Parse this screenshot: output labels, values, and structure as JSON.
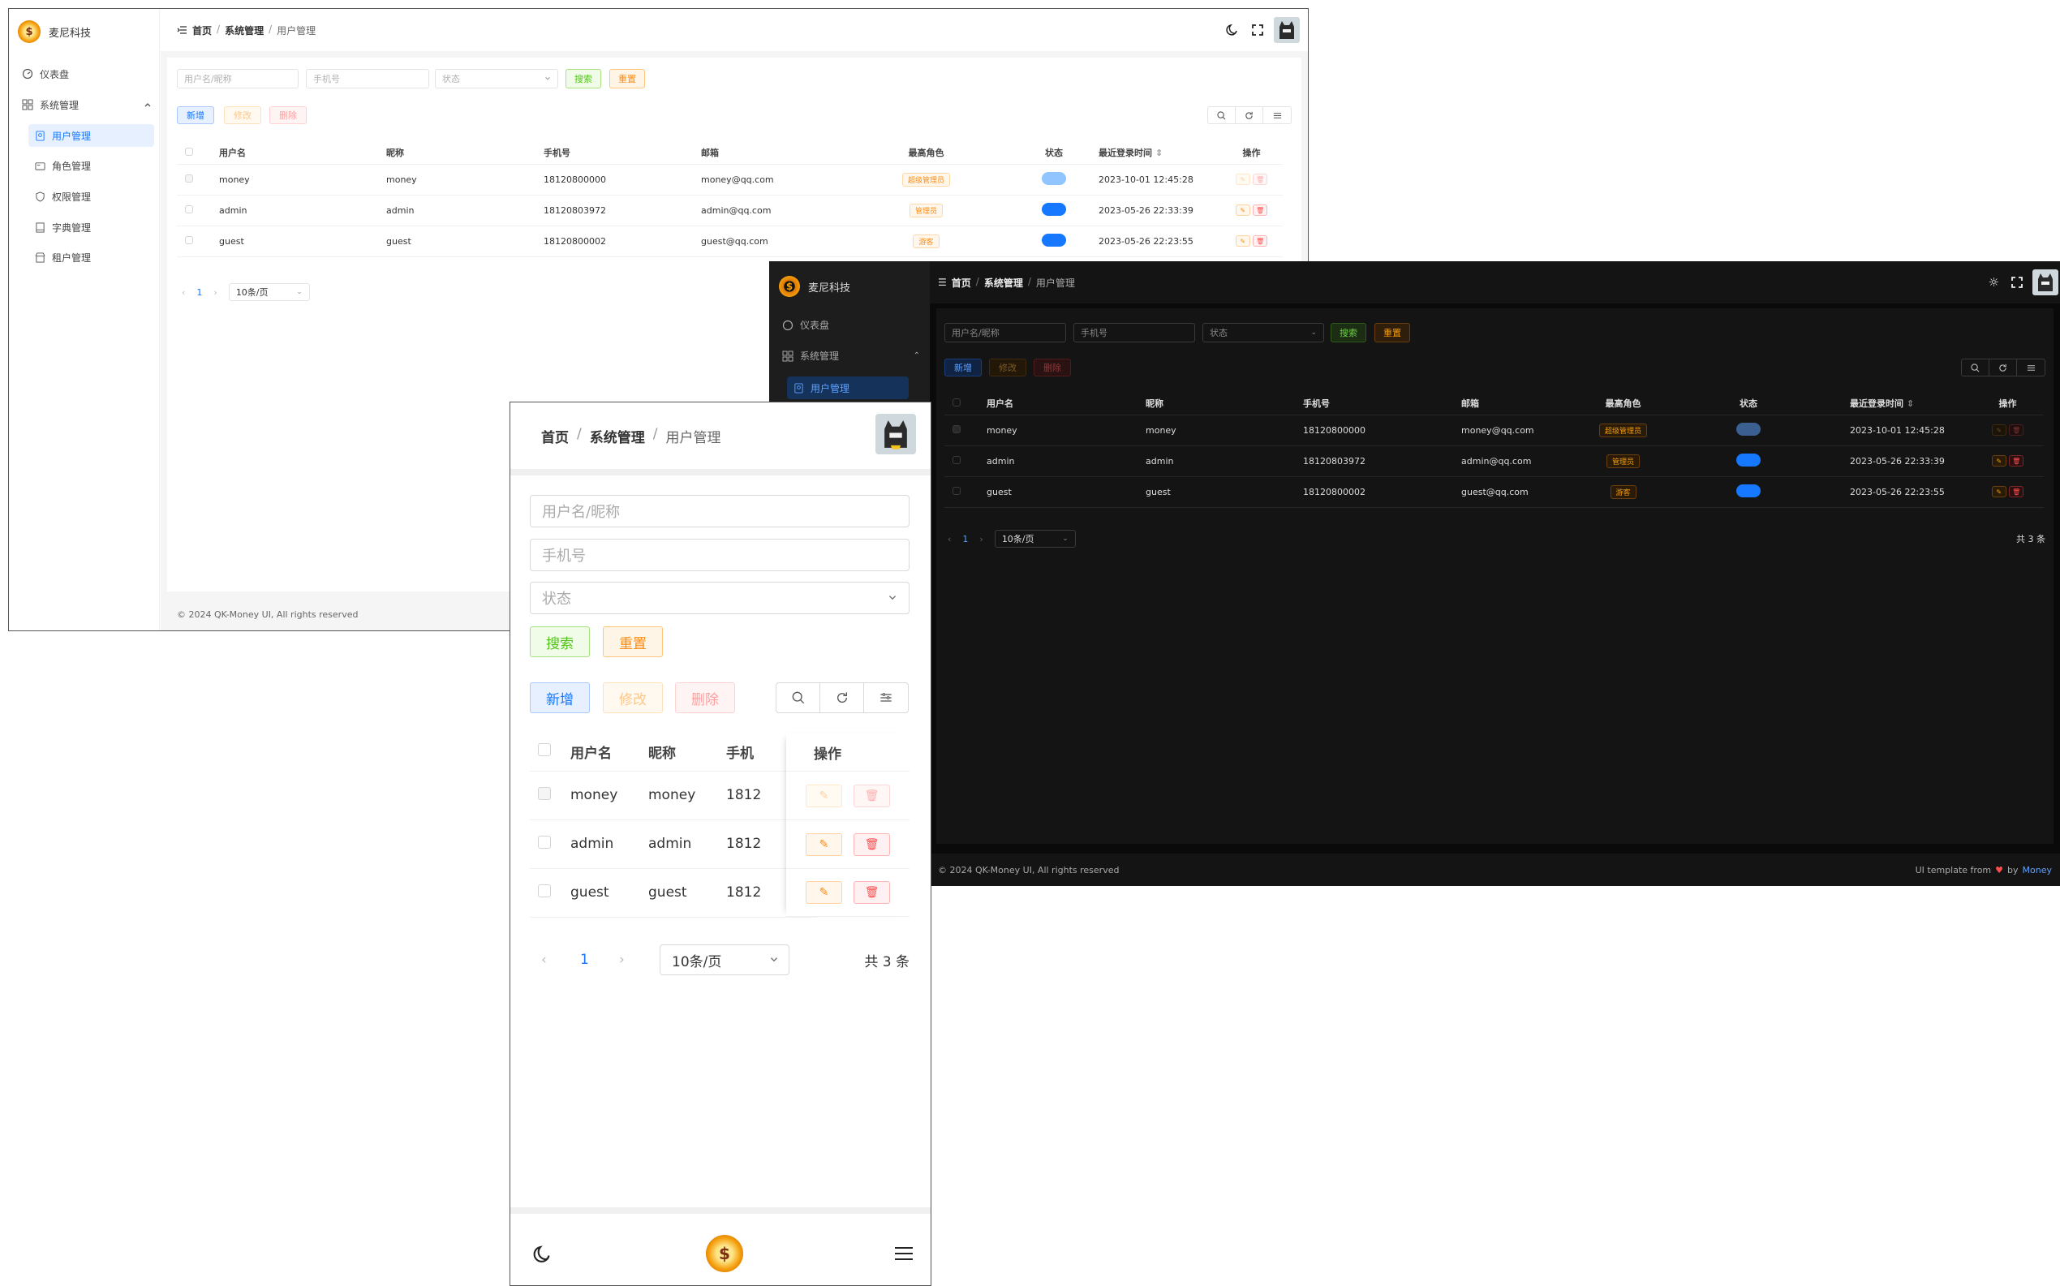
{
  "app": {
    "brand": "麦尼科技",
    "breadcrumb": [
      "首页",
      "系统管理",
      "用户管理"
    ],
    "footer_copyright": "© 2024 QK-Money UI, All rights reserved",
    "footer_credit_prefix": "UI template from",
    "footer_credit_by": "by",
    "footer_credit_author": "Money"
  },
  "sidebar": {
    "dashboard": "仪表盘",
    "system": "系统管理",
    "items": [
      "用户管理",
      "角色管理",
      "权限管理",
      "字典管理",
      "租户管理"
    ],
    "active_index": 0
  },
  "search": {
    "username_placeholder": "用户名/昵称",
    "phone_placeholder": "手机号",
    "status_placeholder": "状态",
    "search_label": "搜索",
    "reset_label": "重置"
  },
  "toolbar": {
    "add_label": "新增",
    "edit_label": "修改",
    "delete_label": "删除"
  },
  "table": {
    "columns": [
      "用户名",
      "昵称",
      "手机号",
      "邮箱",
      "最高角色",
      "状态",
      "最近登录时间",
      "操作"
    ],
    "rows": [
      {
        "username": "money",
        "nickname": "money",
        "phone": "18120800000",
        "email": "money@qq.com",
        "role": "超级管理员",
        "status_on": true,
        "last_login": "2023-10-01 12:45:28"
      },
      {
        "username": "admin",
        "nickname": "admin",
        "phone": "18120803972",
        "email": "admin@qq.com",
        "role": "管理员",
        "status_on": true,
        "last_login": "2023-05-26 22:33:39"
      },
      {
        "username": "guest",
        "nickname": "guest",
        "phone": "18120800002",
        "email": "guest@qq.com",
        "role": "游客",
        "status_on": true,
        "last_login": "2023-05-26 22:23:55"
      }
    ]
  },
  "mobile_table": {
    "phone_truncated": [
      "1812",
      "1812",
      "1812"
    ],
    "phone_header_truncated": "手机"
  },
  "pagination": {
    "current_page": "1",
    "page_size": "10条/页",
    "total": "共 3 条"
  },
  "colors": {
    "primary": "#1677ff",
    "success": "#52c41a",
    "warning": "#fa8c16",
    "danger": "#ff4d4f",
    "dark_bg": "#141414"
  }
}
